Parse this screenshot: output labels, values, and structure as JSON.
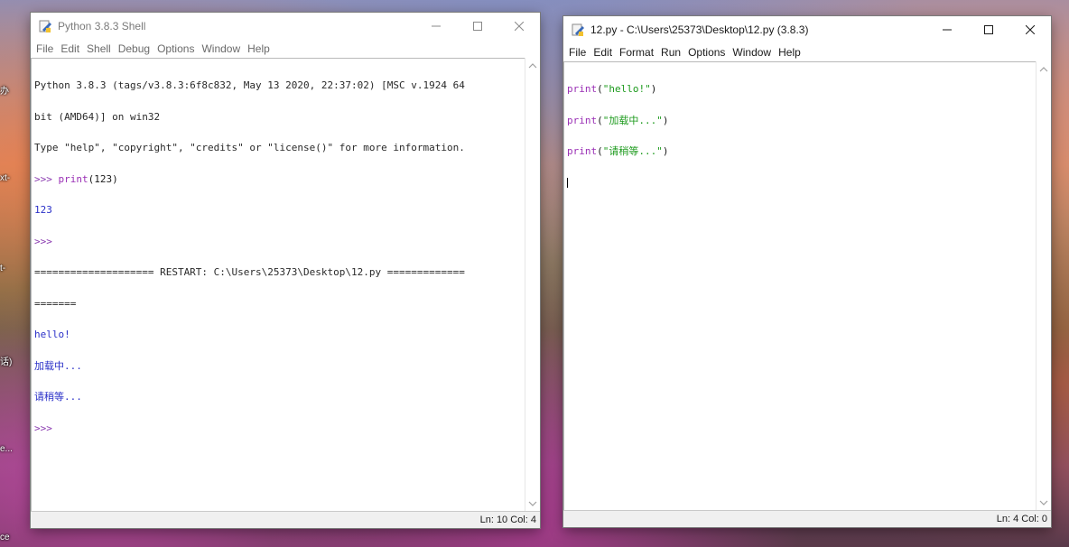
{
  "desktop": {
    "labels": [
      "办",
      "xt-",
      "t-",
      "话)",
      "e...",
      "ce"
    ]
  },
  "shell_window": {
    "title": "Python 3.8.3 Shell",
    "menu": [
      "File",
      "Edit",
      "Shell",
      "Debug",
      "Options",
      "Window",
      "Help"
    ],
    "lines": [
      {
        "text": "Python 3.8.3 (tags/v3.8.3:6f8c832, May 13 2020, 22:37:02) [MSC v.1924 64",
        "kind": "out"
      },
      {
        "text": "bit (AMD64)] on win32",
        "kind": "out"
      },
      {
        "text": "Type \"help\", \"copyright\", \"credits\" or \"license()\" for more information.",
        "kind": "out"
      }
    ],
    "prompt": ">>>",
    "command_keyword": "print",
    "command_rest": "(123)",
    "result": "123",
    "prompt2": ">>>",
    "restart_line": "==================== RESTART: C:\\Users\\25373\\Desktop\\12.py =============",
    "restart_cont": "=======",
    "outputs": [
      "hello!",
      "加载中...",
      "请稍等..."
    ],
    "prompt3": ">>>",
    "status_ln": "Ln: 10",
    "status_col": "Col: 4"
  },
  "editor_window": {
    "title": "12.py - C:\\Users\\25373\\Desktop\\12.py (3.8.3)",
    "menu": [
      "File",
      "Edit",
      "Format",
      "Run",
      "Options",
      "Window",
      "Help"
    ],
    "code": [
      {
        "keyword": "print",
        "open": "(",
        "string": "\"hello!\"",
        "close": ")"
      },
      {
        "keyword": "print",
        "open": "(",
        "string": "\"加载中...\"",
        "close": ")"
      },
      {
        "keyword": "print",
        "open": "(",
        "string": "\"请稍等...\"",
        "close": ")"
      }
    ],
    "status_ln": "Ln: 4",
    "status_col": "Col: 0"
  },
  "colors": {
    "builtin": "#9a2fb5",
    "string": "#1c9a1c",
    "stdout": "#2a30c8",
    "prompt": "#8a3ab0"
  }
}
